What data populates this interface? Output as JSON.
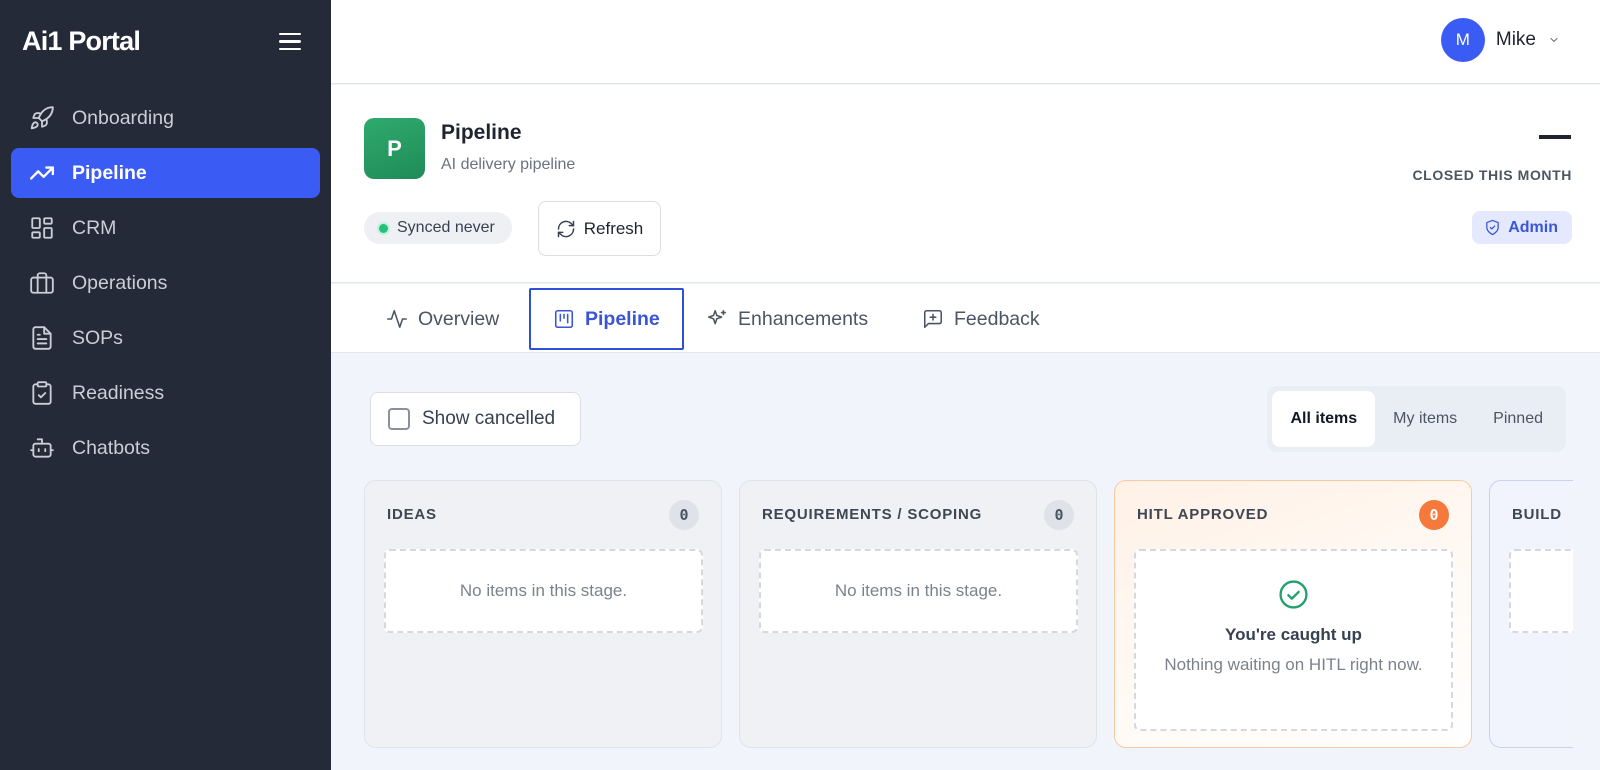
{
  "sidebar": {
    "brand": "Ai1 Portal",
    "menu_icon": "hamburger-icon",
    "items": [
      {
        "label": "Onboarding",
        "icon": "rocket-icon"
      },
      {
        "label": "Pipeline",
        "icon": "trending-up-icon",
        "active": true
      },
      {
        "label": "CRM",
        "icon": "dashboard-grid-icon"
      },
      {
        "label": "Operations",
        "icon": "briefcase-icon"
      },
      {
        "label": "SOPs",
        "icon": "document-icon"
      },
      {
        "label": "Readiness",
        "icon": "clipboard-check-icon"
      },
      {
        "label": "Chatbots",
        "icon": "bot-icon"
      }
    ]
  },
  "topbar": {
    "user": {
      "initial": "M",
      "name": "Mike"
    }
  },
  "header": {
    "badge_letter": "P",
    "title": "Pipeline",
    "subtitle": "AI delivery pipeline",
    "sync_status": "Synced never",
    "refresh_label": "Refresh",
    "closed_value": "—",
    "closed_label": "CLOSED THIS MONTH",
    "role_badge": "Admin"
  },
  "tabs": [
    {
      "label": "Overview",
      "icon": "activity-icon"
    },
    {
      "label": "Pipeline",
      "icon": "kanban-icon",
      "active": true
    },
    {
      "label": "Enhancements",
      "icon": "sparkles-icon"
    },
    {
      "label": "Feedback",
      "icon": "message-plus-icon"
    }
  ],
  "controls": {
    "show_cancelled_label": "Show cancelled",
    "show_cancelled_checked": false,
    "filters": [
      "All items",
      "My items",
      "Pinned"
    ],
    "active_filter": "All items"
  },
  "board": {
    "columns": [
      {
        "title": "IDEAS",
        "count": "0",
        "empty_text": "No items in this stage."
      },
      {
        "title": "REQUIREMENTS / SCOPING",
        "count": "0",
        "empty_text": "No items in this stage."
      },
      {
        "title": "HITL APPROVED",
        "count": "0",
        "caught_title": "You're caught up",
        "caught_text": "Nothing waiting on HITL right now."
      },
      {
        "title": "BUILD"
      }
    ]
  },
  "colors": {
    "sidebar_bg": "#242a37",
    "accent": "#3b5bf5",
    "success": "#22c27a",
    "hitl_accent": "#f4793b",
    "app_badge": "#27a064"
  }
}
